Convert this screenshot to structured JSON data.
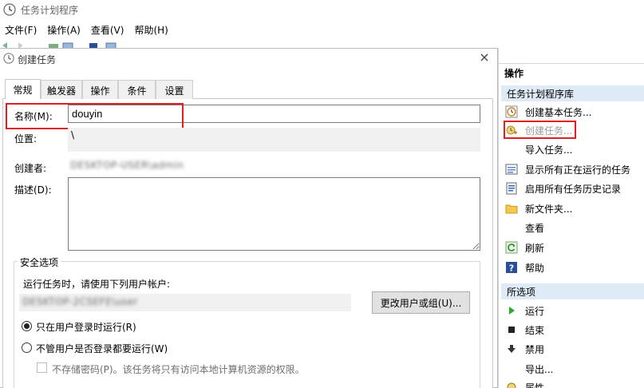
{
  "app": {
    "title": "任务计划程序",
    "menu": [
      "文件(F)",
      "操作(A)",
      "查看(V)",
      "帮助(H)"
    ]
  },
  "dialog": {
    "title": "创建任务",
    "close_glyph": "×",
    "tabs": [
      "常规",
      "触发器",
      "操作",
      "条件",
      "设置"
    ],
    "active_tab": "常规",
    "fields": {
      "name_label": "名称(M):",
      "name_value": "douyin",
      "location_label": "位置:",
      "location_value": "\\",
      "author_label": "创建者:",
      "author_value": "DESKTOP-USER\\admin",
      "description_label": "描述(D):",
      "description_value": ""
    },
    "security": {
      "legend": "安全选项",
      "run_as_text": "运行任务时，请使用下列用户帐户:",
      "account_value": "DESKTOP-2CSEFE\\user",
      "change_button": "更改用户或组(U)...",
      "option_logged_on": "只在用户登录时运行(R)",
      "option_whether_logged": "不管用户是否登录都要运行(W)",
      "option_no_password": "不存储密码(P)。该任务将只有访问本地计算机资源的权限。",
      "selected_option": "option_logged_on"
    }
  },
  "actions_pane": {
    "header": "操作",
    "section_library": "任务计划程序库",
    "library_items": [
      {
        "label": "创建基本任务...",
        "icon": "create-basic-task-icon",
        "disabled": false
      },
      {
        "label": "创建任务...",
        "icon": "create-task-icon",
        "disabled": true
      },
      {
        "label": "导入任务...",
        "icon": "",
        "disabled": false
      },
      {
        "label": "显示所有正在运行的任务",
        "icon": "running-tasks-icon",
        "disabled": false
      },
      {
        "label": "启用所有任务历史记录",
        "icon": "history-icon",
        "disabled": false
      },
      {
        "label": "新文件夹...",
        "icon": "folder-icon",
        "disabled": false
      },
      {
        "label": "查看",
        "icon": "",
        "disabled": false
      },
      {
        "label": "刷新",
        "icon": "refresh-icon",
        "disabled": false
      },
      {
        "label": "帮助",
        "icon": "help-icon",
        "disabled": false
      }
    ],
    "section_selected": "所选项",
    "selected_items": [
      {
        "label": "运行",
        "icon": "run-icon"
      },
      {
        "label": "结束",
        "icon": "stop-icon"
      },
      {
        "label": "禁用",
        "icon": "disable-icon"
      },
      {
        "label": "导出...",
        "icon": ""
      },
      {
        "label": "属性",
        "icon": "properties-icon"
      }
    ]
  },
  "colors": {
    "highlight_red": "#e02020",
    "section_blue": "#dfeaf7",
    "readonly_gray": "#f0f0f0"
  }
}
